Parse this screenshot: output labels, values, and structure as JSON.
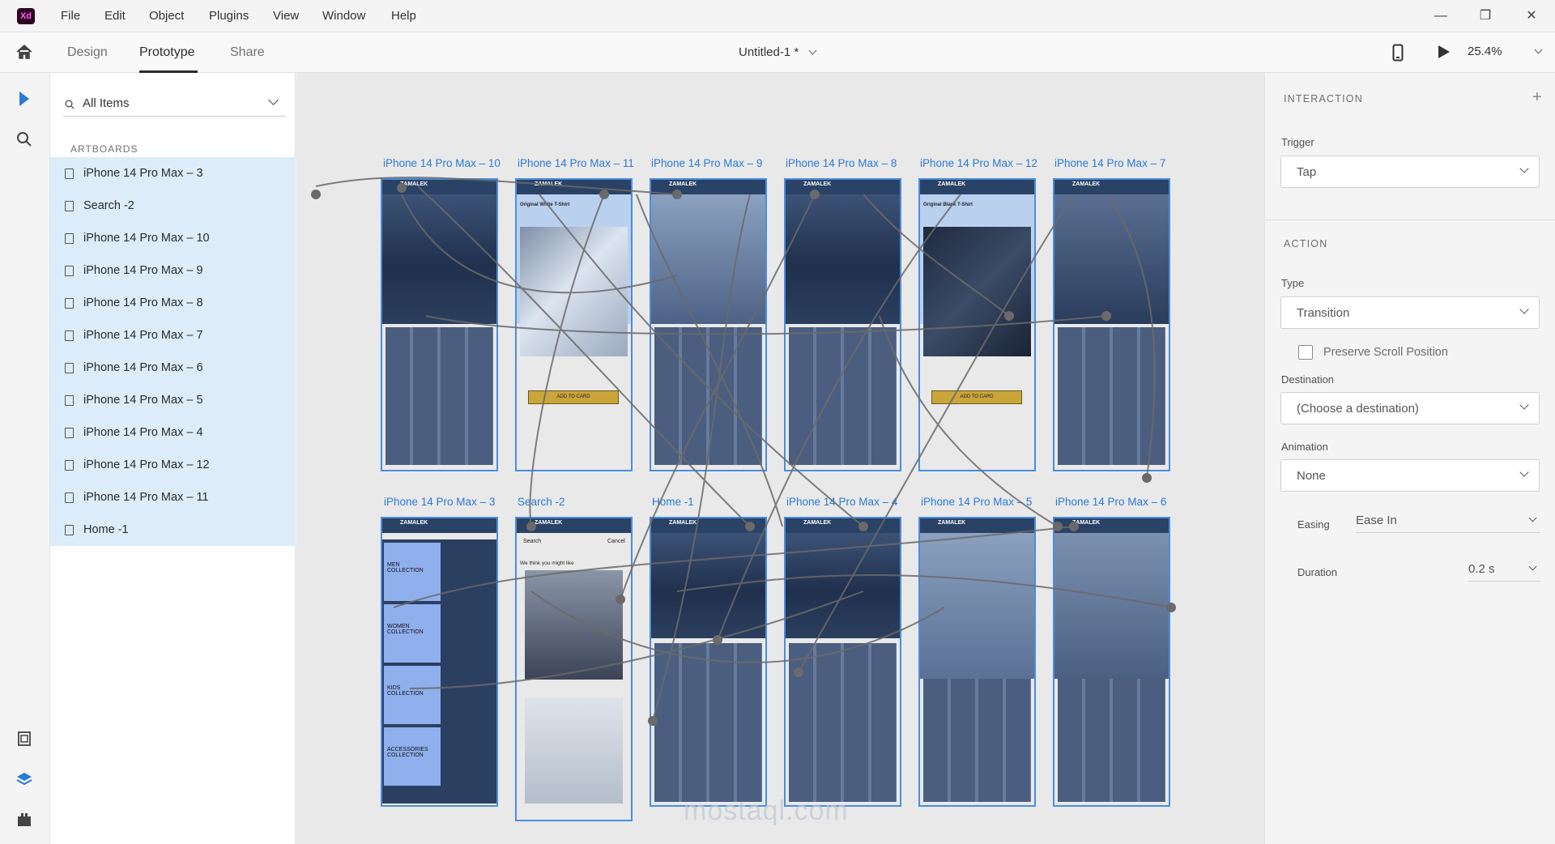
{
  "app": {
    "logo": "Xd"
  },
  "menu": [
    "File",
    "Edit",
    "Object",
    "Plugins",
    "View",
    "Window",
    "Help"
  ],
  "toolbar": {
    "tabs": [
      "Design",
      "Prototype",
      "Share"
    ],
    "active_tab": "Prototype",
    "doc_title": "Untitled-1 *",
    "zoom": "25.4%"
  },
  "layers": {
    "filter": "All Items",
    "heading": "ARTBOARDS",
    "items": [
      "iPhone 14 Pro Max – 3",
      "Search -2",
      "iPhone 14 Pro Max – 10",
      "iPhone 14 Pro Max – 9",
      "iPhone 14 Pro Max – 8",
      "iPhone 14 Pro Max – 7",
      "iPhone 14 Pro Max – 6",
      "iPhone 14 Pro Max – 5",
      "iPhone 14 Pro Max – 4",
      "iPhone 14 Pro Max – 12",
      "iPhone 14 Pro Max – 11",
      "Home -1"
    ]
  },
  "canvas": {
    "row1": [
      "iPhone 14 Pro Max – 10",
      "iPhone 14 Pro Max – 11",
      "iPhone 14 Pro Max – 9",
      "iPhone 14 Pro Max – 8",
      "iPhone 14 Pro Max – 12",
      "iPhone 14 Pro Max – 7"
    ],
    "row2": [
      "iPhone 14 Pro Max – 3",
      "Search -2",
      "Home -1",
      "iPhone 14 Pro Max – 4",
      "iPhone 14 Pro Max – 5",
      "iPhone 14 Pro Max – 6"
    ],
    "brand": "ZAMALEK",
    "ab11_product": "Original White T-Shirt",
    "ab12_product": "Original Black T-Shirt",
    "add_to_cart": "ADD TO CARD",
    "search_placeholder": "Search",
    "search_cancel": "Cancel",
    "search_suggest": "We think you might like",
    "collections": [
      "MEN COLLECTION",
      "WOMEN COLLECTION",
      "KIDS COLLECTION",
      "ACCESSORIES COLLECTION"
    ],
    "watermark": "mostaql.com"
  },
  "interaction": {
    "title": "INTERACTION",
    "trigger_label": "Trigger",
    "trigger": "Tap",
    "action_title": "ACTION",
    "type_label": "Type",
    "type": "Transition",
    "preserve_scroll": "Preserve Scroll Position",
    "destination_label": "Destination",
    "destination": "(Choose a destination)",
    "animation_label": "Animation",
    "animation": "None",
    "easing_label": "Easing",
    "easing": "Ease In",
    "duration_label": "Duration",
    "duration": "0.2 s"
  },
  "colors": {
    "accent": "#2b7ad6",
    "selection": "#dcecf9",
    "artboard_dark": "#2a4266"
  }
}
